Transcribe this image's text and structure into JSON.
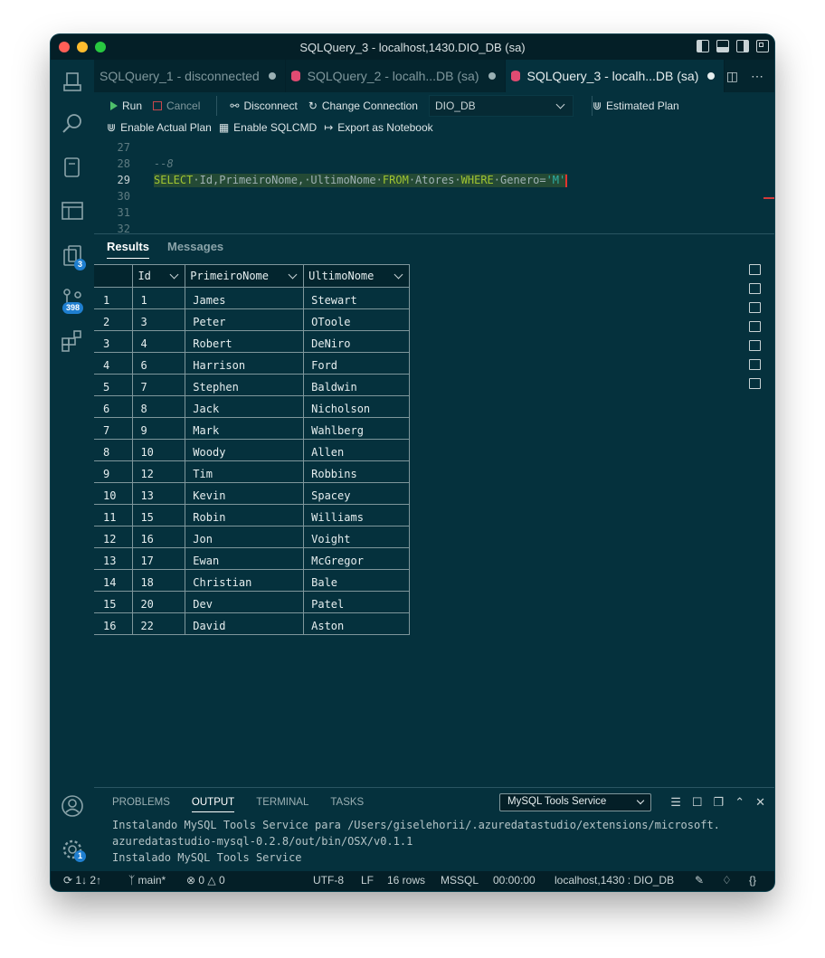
{
  "window": {
    "title": "SQLQuery_3 - localhost,1430.DIO_DB (sa)"
  },
  "tabs": [
    {
      "label": "SQLQuery_1 - disconnected"
    },
    {
      "label": "SQLQuery_2 - localh...DB (sa)"
    },
    {
      "label": "SQLQuery_3 - localh...DB (sa)"
    }
  ],
  "activity": {
    "explorer_badge": "3",
    "scm_badge": "398",
    "settings_badge": "1"
  },
  "toolbar": {
    "run": "Run",
    "cancel": "Cancel",
    "disconnect": "Disconnect",
    "change_connection": "Change Connection",
    "database": "DIO_DB",
    "estimated_plan": "Estimated Plan",
    "enable_actual_plan": "Enable Actual Plan",
    "enable_sqlcmd": "Enable SQLCMD",
    "export_notebook": "Export as Notebook"
  },
  "editor": {
    "lines": [
      "27",
      "28",
      "29",
      "30",
      "31",
      "32"
    ],
    "comment": "--8",
    "sql": {
      "select": "SELECT",
      "cols": "Id,PrimeiroNome,·UltimoNome",
      "from": "FROM",
      "table": "Atores",
      "where": "WHERE",
      "cond": "Genero=",
      "value": "'M'"
    }
  },
  "results": {
    "tab_results": "Results",
    "tab_messages": "Messages",
    "columns": [
      "Id",
      "PrimeiroNome",
      "UltimoNome"
    ],
    "rows": [
      [
        "1",
        "1",
        "James",
        "Stewart"
      ],
      [
        "2",
        "3",
        "Peter",
        "OToole"
      ],
      [
        "3",
        "4",
        "Robert",
        "DeNiro"
      ],
      [
        "4",
        "6",
        "Harrison",
        "Ford"
      ],
      [
        "5",
        "7",
        "Stephen",
        "Baldwin"
      ],
      [
        "6",
        "8",
        "Jack",
        "Nicholson"
      ],
      [
        "7",
        "9",
        "Mark",
        "Wahlberg"
      ],
      [
        "8",
        "10",
        "Woody",
        "Allen"
      ],
      [
        "9",
        "12",
        "Tim",
        "Robbins"
      ],
      [
        "10",
        "13",
        "Kevin",
        "Spacey"
      ],
      [
        "11",
        "15",
        "Robin",
        "Williams"
      ],
      [
        "12",
        "16",
        "Jon",
        "Voight"
      ],
      [
        "13",
        "17",
        "Ewan",
        "McGregor"
      ],
      [
        "14",
        "18",
        "Christian",
        "Bale"
      ],
      [
        "15",
        "20",
        "Dev",
        "Patel"
      ],
      [
        "16",
        "22",
        "David",
        "Aston"
      ]
    ]
  },
  "panel": {
    "tabs": [
      "PROBLEMS",
      "OUTPUT",
      "TERMINAL",
      "TASKS"
    ],
    "channel": "MySQL Tools Service",
    "output": [
      "Instalando MySQL Tools Service para /Users/giselehorii/.azuredatastudio/extensions/microsoft.",
      "azuredatastudio-mysql-0.2.8/out/bin/OSX/v0.1.1",
      "Instalado MySQL Tools Service"
    ]
  },
  "status": {
    "sync": "1↓ 2↑",
    "branch": "main*",
    "errors": "0",
    "warnings": "0",
    "encoding": "UTF-8",
    "eol": "LF",
    "rows": "16 rows",
    "lang": "MSSQL",
    "time": "00:00:00",
    "connection": "localhost,1430 : DIO_DB"
  }
}
